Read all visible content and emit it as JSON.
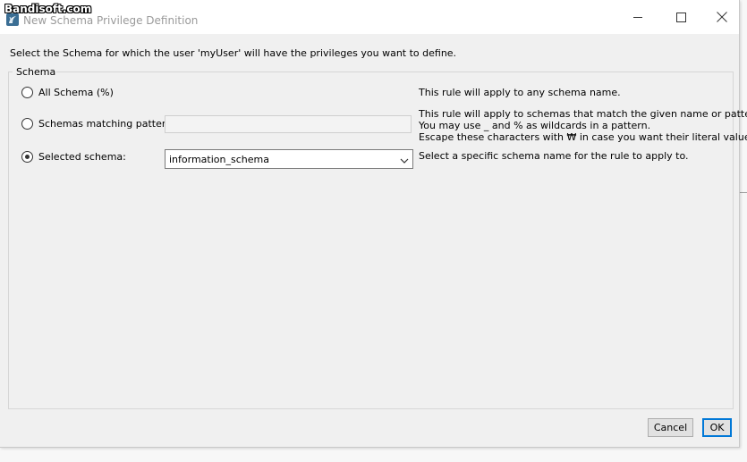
{
  "window": {
    "title": "New Schema Privilege Definition",
    "watermark": "Bandisoft.com"
  },
  "instruction": "Select the Schema for which the user 'myUser' will have the privileges you want to define.",
  "group": {
    "legend": "Schema"
  },
  "options": {
    "all": {
      "label": "All Schema (%)",
      "checked": false,
      "description": "This rule will apply to any schema name."
    },
    "pattern": {
      "label": "Schemas matching pattern:",
      "checked": false,
      "value": "",
      "description_lines": [
        "This rule will apply to schemas that match the given name or pattern.",
        "You may use _ and % as wildcards in a pattern.",
        "Escape these characters with ₩ in case you want their literal value."
      ]
    },
    "selected": {
      "label": "Selected schema:",
      "checked": true,
      "value": "information_schema",
      "description": "Select a specific schema name for the rule to apply to."
    }
  },
  "buttons": {
    "cancel": "Cancel",
    "ok": "OK"
  },
  "colors": {
    "accent": "#0078d7",
    "title_text": "#9a9a9a"
  }
}
